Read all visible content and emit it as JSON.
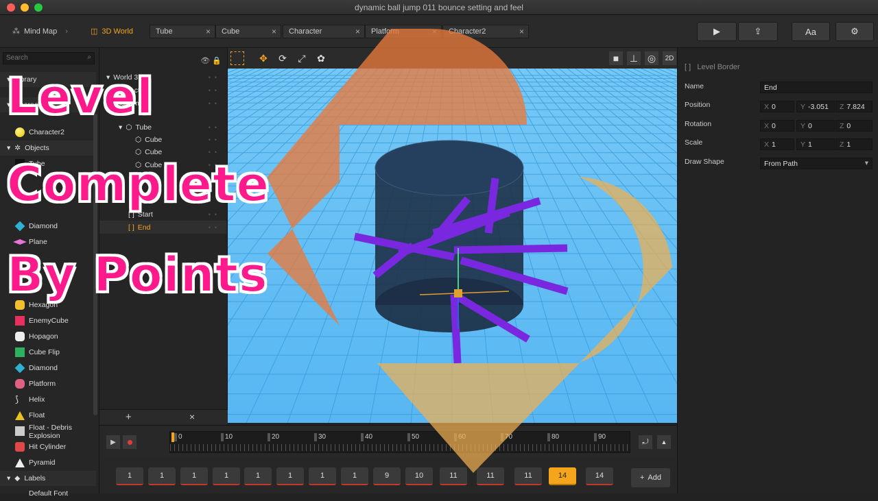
{
  "window": {
    "title": "dynamic ball jump 011 bounce setting and feel"
  },
  "breadcrumb": {
    "mindmap": "Mind Map",
    "world": "3D World"
  },
  "tabs": [
    "Tube",
    "Cube",
    "Character",
    "Platform",
    "Character2"
  ],
  "toolbar": {
    "play": "▶",
    "share": "⇪",
    "font": "Aa",
    "settings": "⚙"
  },
  "library": {
    "search_placeholder": "Search",
    "items_top": [
      "Library",
      "Characters",
      "Character2",
      "Objects",
      "Tube",
      "Cube",
      "Debris",
      "Diamond",
      "Plane",
      "Rotating Platform",
      "Diamond",
      "Hexagon"
    ],
    "items": [
      "Character2",
      "Objects",
      "Tube",
      "Diamond",
      "Plane",
      "Hexagon",
      "EnemyCube",
      "Hopagon",
      "Cube Flip",
      "Diamond",
      "Platform",
      "Helix",
      "Float",
      "Float - Debris Explosion",
      "Hit Cylinder",
      "Pyramid",
      "Labels",
      "Default Font"
    ]
  },
  "tree": {
    "items": [
      "World 3D",
      "Character",
      "Platform",
      "Tube",
      "Cube",
      "Cube",
      "Cube",
      "Cube",
      "Start",
      "End"
    ]
  },
  "properties": {
    "header": "Level Border",
    "name_label": "Name",
    "name_value": "End",
    "position_label": "Position",
    "pos_x": "0",
    "pos_y": "-3.051",
    "pos_z": "7.824",
    "rotation_label": "Rotation",
    "rot_x": "0",
    "rot_y": "0",
    "rot_z": "0",
    "scale_label": "Scale",
    "scale_x": "1",
    "scale_y": "1",
    "scale_z": "1",
    "drawshape_label": "Draw Shape",
    "drawshape_value": "From Path"
  },
  "timeline": {
    "ticks": [
      "0",
      "10",
      "20",
      "30",
      "40",
      "50",
      "60",
      "70",
      "80",
      "90"
    ]
  },
  "keys": [
    "1",
    "1",
    "1",
    "1",
    "1",
    "1",
    "1",
    "1",
    "9",
    "10",
    "11",
    "11",
    "11",
    "14",
    "14"
  ],
  "keys_active_index": 13,
  "add_label": "Add",
  "overlay": {
    "line1": "Level",
    "line2": "Complete",
    "line3": "By Points"
  },
  "colors": {
    "accent": "#f4a51c",
    "brand_pink": "#ff1a8c",
    "sky": "#5cbcf5"
  }
}
